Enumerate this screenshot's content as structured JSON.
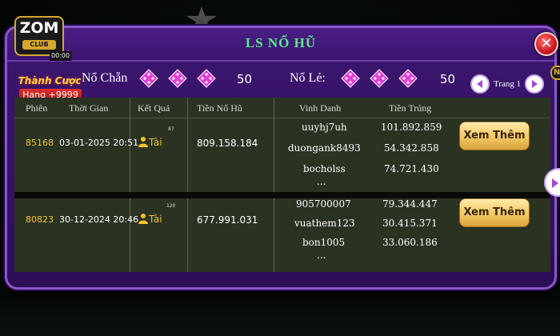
{
  "popup": {
    "title": "LS NỔ HŨ"
  },
  "logo": {
    "main": "ZOM",
    "sub": "CLUB",
    "time": "00:00"
  },
  "rank_badge": {
    "title": "Thành Cược",
    "value": "Hạng +9999"
  },
  "summary": {
    "even_label": "Nổ Chẵn",
    "even_value": "50",
    "odd_label": "Nổ Lẻ:",
    "odd_value": "50",
    "page_label": "Trang 1"
  },
  "side_tab": "N",
  "table": {
    "headers": [
      "Phiên",
      "Thời Gian",
      "Kết Quả",
      "Tiền Nổ Hũ",
      "Vinh Danh",
      "Tiền Trúng"
    ],
    "rows": [
      {
        "session": "85168",
        "time": "03-01-2025 20:51",
        "result": "Tài",
        "result_sup": "87",
        "jackpot": "809.158.184",
        "winners": [
          "uuyhj7uh",
          "duongank8493",
          "bocholss"
        ],
        "prizes": [
          "101.892.859",
          "54.342.858",
          "74.721.430"
        ],
        "ellipsis": "...",
        "more_label": "Xem Thêm"
      },
      {
        "session": "80823",
        "time": "30-12-2024 20:46",
        "result": "Tài",
        "result_sup": "120",
        "jackpot": "677.991.031",
        "winners": [
          "905700007",
          "vuathem123",
          "bon1005"
        ],
        "prizes": [
          "79.344.447",
          "30.415.371",
          "33.060.186"
        ],
        "ellipsis": "...",
        "more_label": "Xem Thêm"
      }
    ]
  },
  "icons": {
    "dice": "dice-icon",
    "close": "close-icon",
    "prev": "chevron-left-icon",
    "next": "chevron-right-icon",
    "user": "user-icon"
  },
  "colors": {
    "panel": "#3d1670",
    "title_green": "#5ee88e",
    "dice_pink": "#e43fd6",
    "gold": "#f2c530"
  }
}
